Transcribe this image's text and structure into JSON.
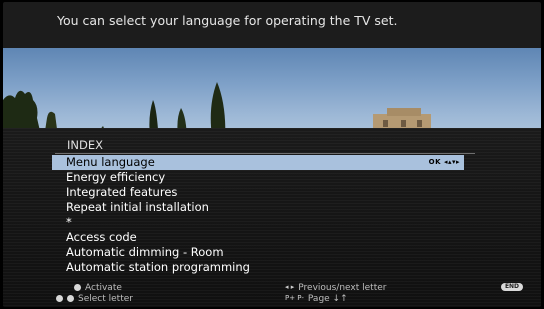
{
  "header": {
    "message": "You can select your language for operating the TV set."
  },
  "index": {
    "title": "INDEX",
    "items": [
      "Menu language",
      "Energy efficiency",
      "Integrated features",
      "Repeat initial installation",
      "*",
      "Access code",
      "Automatic dimming - Room",
      "Automatic station programming"
    ],
    "selected_index": 0,
    "selected_hint_ok": "OK",
    "selected_hint_arrows": "◂▴▾▸"
  },
  "footer": {
    "activate_label": "Activate",
    "select_letter_label": "Select letter",
    "prev_next_label": "Previous/next letter",
    "page_label": "Page ↓↑",
    "end_label": "END",
    "prev_next_glyph": "◂ ▸",
    "page_glyph": "P+ P-",
    "select_letter_glyph": "◂ ▸"
  },
  "colors": {
    "selection": "#a9c1dd",
    "panel": "#141414",
    "text": "#ffffff"
  }
}
